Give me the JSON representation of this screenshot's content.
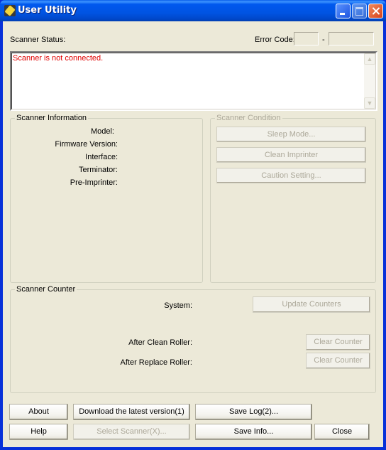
{
  "window": {
    "title": "User Utility",
    "icon": "wrench-app-icon"
  },
  "titlebar_buttons": [
    "minimize",
    "maximize",
    "close"
  ],
  "status": {
    "label": "Scanner Status:",
    "message": "Scanner is not connected.",
    "message_color": "#e00000"
  },
  "error_code": {
    "label": "Error Code:",
    "separator": "-",
    "code1": "",
    "code2": ""
  },
  "scanner_information": {
    "title": "Scanner Information",
    "fields": [
      {
        "label": "Model:",
        "value": ""
      },
      {
        "label": "Firmware Version:",
        "value": ""
      },
      {
        "label": "Interface:",
        "value": ""
      },
      {
        "label": "Terminator:",
        "value": ""
      },
      {
        "label": "Pre-Imprinter:",
        "value": ""
      }
    ]
  },
  "scanner_condition": {
    "title": "Scanner Condition",
    "buttons": [
      "Sleep Mode...",
      "Clean Imprinter",
      "Caution Setting..."
    ]
  },
  "scanner_counter": {
    "title": "Scanner Counter",
    "system_label": "System:",
    "update_button": "Update Counters",
    "after_clean_label": "After Clean Roller:",
    "after_replace_label": "After Replace Roller:",
    "clear_counter_button": "Clear Counter"
  },
  "footer": {
    "about": "About",
    "download": "Download the latest version(1)",
    "save_log": "Save Log(2)...",
    "help": "Help",
    "select_scanner": "Select Scanner(X)...",
    "save_info": "Save Info...",
    "close": "Close"
  }
}
